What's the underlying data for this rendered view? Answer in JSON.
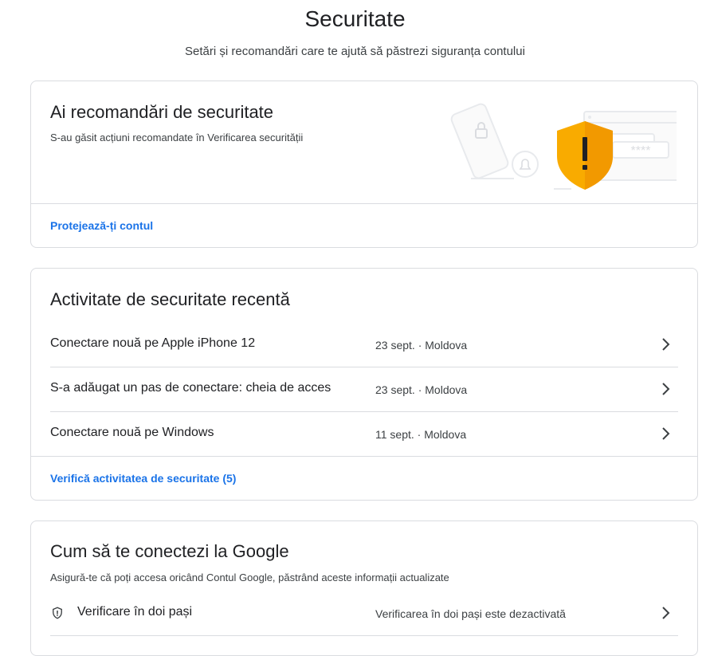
{
  "header": {
    "title": "Securitate",
    "subtitle": "Setări și recomandări care te ajută să păstrezi siguranța contului"
  },
  "recommendations": {
    "title": "Ai recomandări de securitate",
    "description": "S-au găsit acțiuni recomandate în Verificarea securității",
    "link": "Protejează-ți contul",
    "illustration_icons": [
      "phone-lock-icon",
      "bell-icon",
      "warning-shield-icon",
      "password-field-icon"
    ],
    "shield_color": "#f9ab00",
    "password_mask": "****"
  },
  "activity": {
    "title": "Activitate de securitate recentă",
    "items": [
      {
        "label": "Conectare nouă pe Apple iPhone 12",
        "meta": "23 sept. · Moldova"
      },
      {
        "label": "S-a adăugat un pas de conectare: cheia de acces",
        "meta": "23 sept. · Moldova"
      },
      {
        "label": "Conectare nouă pe Windows",
        "meta": "11 sept. · Moldova"
      }
    ],
    "link": "Verifică activitatea de securitate (5)"
  },
  "signin": {
    "title": "Cum să te conectezi la Google",
    "description": "Asigură-te că poți accesa oricând Contul Google, păstrând aceste informații actualizate",
    "items": [
      {
        "icon": "shield-icon",
        "label": "Verificare în doi pași",
        "meta": "Verificarea în doi pași este dezactivată"
      }
    ]
  },
  "colors": {
    "link": "#1a73e8",
    "border": "#dadce0",
    "text": "#202124"
  }
}
